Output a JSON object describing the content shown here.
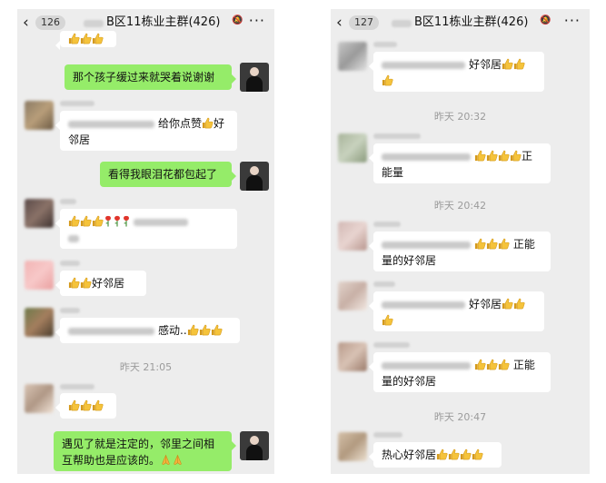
{
  "left": {
    "back_count": "126",
    "title": "B区11栋业主群(426)",
    "more": "···",
    "msgs": {
      "m1": "那个孩子缓过来就哭着说谢谢",
      "m2": "给你点赞",
      "m2b": "好",
      "m2c": "邻居",
      "m3": "看得我眼泪花都包起了",
      "m5": "好邻居",
      "m6": "感动..",
      "ts1": "昨天 21:05",
      "m8": "遇见了就是注定的，邻里之间相",
      "m8b": "互帮助也是应该的。"
    }
  },
  "right": {
    "back_count": "127",
    "title": "B区11栋业主群(426)",
    "more": "···",
    "msgs": {
      "m1": "好邻居",
      "ts1": "昨天 20:32",
      "m2a": "正",
      "m2b": "能量",
      "ts2": "昨天 20:42",
      "m3a": "正能",
      "m3b": "量的好邻居",
      "m4": "好邻居",
      "m5a": "正能",
      "m5b": "量的好邻居",
      "ts3": "昨天 20:47",
      "m6": "热心好邻居"
    }
  },
  "icons": {
    "thumb": "thumbs-up-emoji",
    "rose": "rose-emoji",
    "pray": "pray-emoji",
    "back": "chevron-left-icon",
    "mute": "bell-muted-icon"
  },
  "colors": {
    "chat_bg": "#ededed",
    "bubble_out": "#95ec69",
    "bubble_in": "#ffffff",
    "timestamp": "#9b9b9b"
  }
}
